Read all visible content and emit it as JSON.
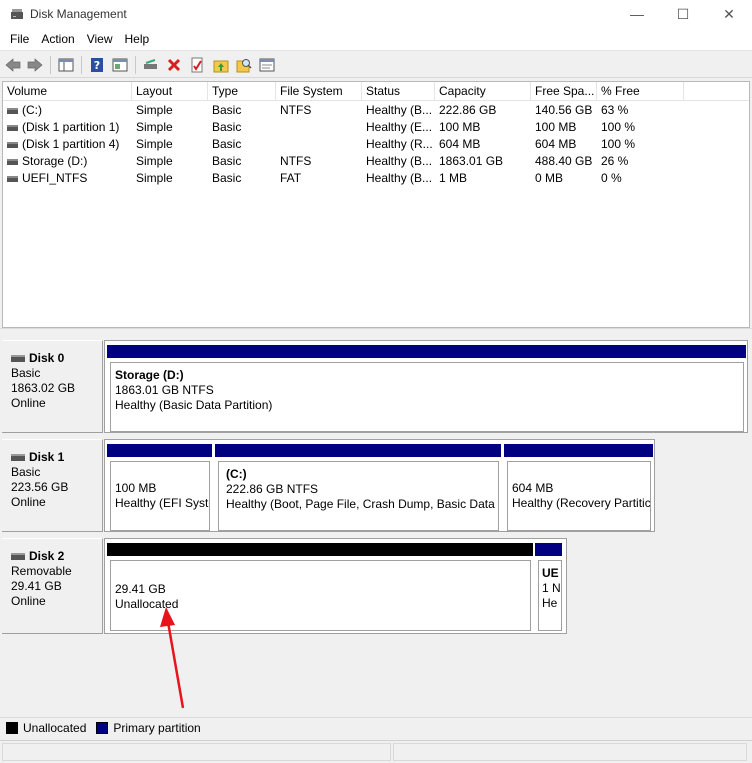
{
  "window": {
    "title": "Disk Management",
    "minimize_glyph": "—",
    "maximize_glyph": "☐",
    "close_glyph": "✕"
  },
  "menu": [
    "File",
    "Action",
    "View",
    "Help"
  ],
  "toolbar": {
    "icons": [
      "back-arrow-icon",
      "forward-arrow-icon",
      "show-hide-console-tree-icon",
      "help-icon",
      "properties-icon",
      "connect-drive-icon",
      "delete-icon",
      "check-icon",
      "up-folder-icon",
      "find-icon",
      "console-icon"
    ]
  },
  "volume_list": {
    "columns": [
      "Volume",
      "Layout",
      "Type",
      "File System",
      "Status",
      "Capacity",
      "Free Spa...",
      "% Free"
    ],
    "rows": [
      [
        "(C:)",
        "Simple",
        "Basic",
        "NTFS",
        "Healthy (B...",
        "222.86 GB",
        "140.56 GB",
        "63 %"
      ],
      [
        "(Disk 1 partition 1)",
        "Simple",
        "Basic",
        "",
        "Healthy (E...",
        "100 MB",
        "100 MB",
        "100 %"
      ],
      [
        "(Disk 1 partition 4)",
        "Simple",
        "Basic",
        "",
        "Healthy (R...",
        "604 MB",
        "604 MB",
        "100 %"
      ],
      [
        "Storage (D:)",
        "Simple",
        "Basic",
        "NTFS",
        "Healthy (B...",
        "1863.01 GB",
        "488.40 GB",
        "26 %"
      ],
      [
        "UEFI_NTFS",
        "Simple",
        "Basic",
        "FAT",
        "Healthy (B...",
        "1 MB",
        "0 MB",
        "0 %"
      ]
    ]
  },
  "disks": [
    {
      "name": "Disk 0",
      "type": "Basic",
      "size": "1863.02 GB",
      "state": "Online",
      "partitions": [
        {
          "title": "Storage  (D:)",
          "line1": "1863.01 GB NTFS",
          "line2": "Healthy (Basic Data Partition)",
          "kind": "primary"
        }
      ]
    },
    {
      "name": "Disk 1",
      "type": "Basic",
      "size": "223.56 GB",
      "state": "Online",
      "partitions": [
        {
          "title": "",
          "line1": "100 MB",
          "line2": "Healthy (EFI Syste",
          "kind": "primary"
        },
        {
          "title": "(C:)",
          "line1": "222.86 GB NTFS",
          "line2": "Healthy (Boot, Page File, Crash Dump, Basic Data Pa",
          "kind": "primary"
        },
        {
          "title": "",
          "line1": "604 MB",
          "line2": "Healthy (Recovery Partitic",
          "kind": "primary"
        }
      ]
    },
    {
      "name": "Disk 2",
      "type": "Removable",
      "size": "29.41 GB",
      "state": "Online",
      "partitions": [
        {
          "title": "",
          "line1": "29.41 GB",
          "line2": "Unallocated",
          "kind": "unallocated"
        },
        {
          "title": "UE",
          "line1": "1 N",
          "line2": "He",
          "kind": "primary"
        }
      ]
    }
  ],
  "legend": [
    {
      "label": "Unallocated",
      "color": "#000000"
    },
    {
      "label": "Primary partition",
      "color": "#000080"
    }
  ],
  "colors": {
    "primary": "#000080",
    "unallocated": "#000000",
    "annotation": "#e8141c"
  }
}
